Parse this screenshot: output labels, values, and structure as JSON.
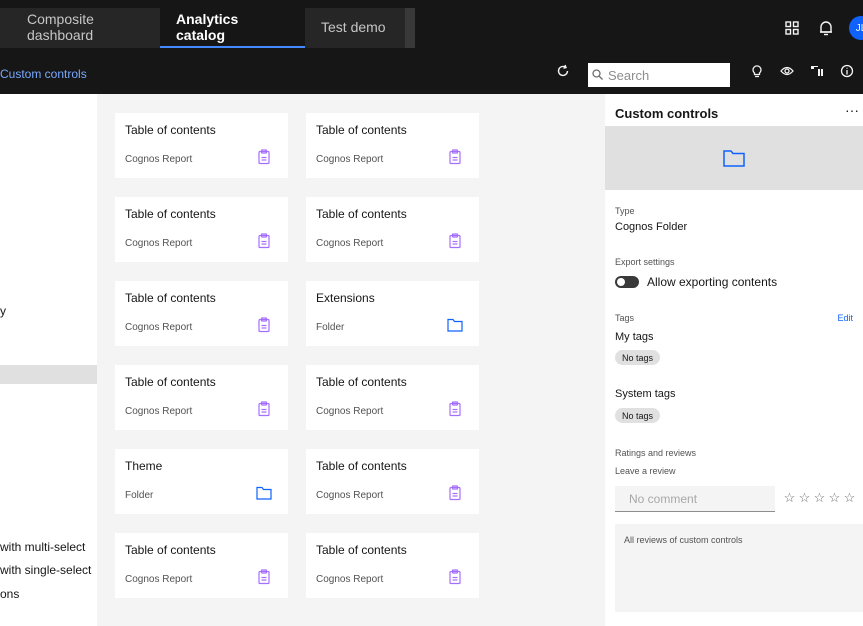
{
  "topbar": {
    "tabs": [
      {
        "label": "Composite dashboard"
      },
      {
        "label": "Analytics catalog"
      },
      {
        "label": "Test demo"
      }
    ],
    "avatar_initials": "JL",
    "icons": [
      "switcher-icon",
      "notification-icon"
    ]
  },
  "subbar": {
    "breadcrumb": "Custom controls",
    "search_placeholder": "Search",
    "icons": [
      "refresh-icon",
      "search-icon",
      "lightbulb-icon",
      "view-icon",
      "lineage-icon",
      "info-icon"
    ]
  },
  "left": {
    "partial_item": "y",
    "items": [
      "with multi-select",
      "with single-select",
      "ons"
    ]
  },
  "cards": [
    {
      "title": "Table of contents",
      "type": "Cognos Report",
      "icon": "report-icon"
    },
    {
      "title": "Table of contents",
      "type": "Cognos Report",
      "icon": "report-icon"
    },
    {
      "title": "Table of contents",
      "type": "Cognos Report",
      "icon": "report-icon"
    },
    {
      "title": "Table of contents",
      "type": "Cognos Report",
      "icon": "report-icon"
    },
    {
      "title": "Table of contents",
      "type": "Cognos Report",
      "icon": "report-icon"
    },
    {
      "title": "Extensions",
      "type": "Folder",
      "icon": "folder-icon"
    },
    {
      "title": "Table of contents",
      "type": "Cognos Report",
      "icon": "report-icon"
    },
    {
      "title": "Table of contents",
      "type": "Cognos Report",
      "icon": "report-icon"
    },
    {
      "title": "Theme",
      "type": "Folder",
      "icon": "folder-icon"
    },
    {
      "title": "Table of contents",
      "type": "Cognos Report",
      "icon": "report-icon"
    },
    {
      "title": "Table of contents",
      "type": "Cognos Report",
      "icon": "report-icon"
    },
    {
      "title": "Table of contents",
      "type": "Cognos Report",
      "icon": "report-icon"
    }
  ],
  "details": {
    "title": "Custom controls",
    "menu": "···",
    "type_label": "Type",
    "type_value": "Cognos Folder",
    "export_label": "Export settings",
    "export_toggle_label": "Allow exporting contents",
    "export_toggle_on": false,
    "tags_label": "Tags",
    "edit_label": "Edit",
    "my_tags_label": "My tags",
    "my_tags_value": "No tags",
    "system_tags_label": "System tags",
    "system_tags_value": "No tags",
    "ratings_label": "Ratings and reviews",
    "leave_review_label": "Leave a review",
    "comment_placeholder": "No comment",
    "stars": 5,
    "rating": 0,
    "all_reviews_label": "All reviews of custom controls"
  },
  "colors": {
    "accent": "#0f62fe",
    "active_tab_underline": "#4589ff",
    "report_icon": "#a56eff",
    "folder_icon": "#0f62fe"
  }
}
